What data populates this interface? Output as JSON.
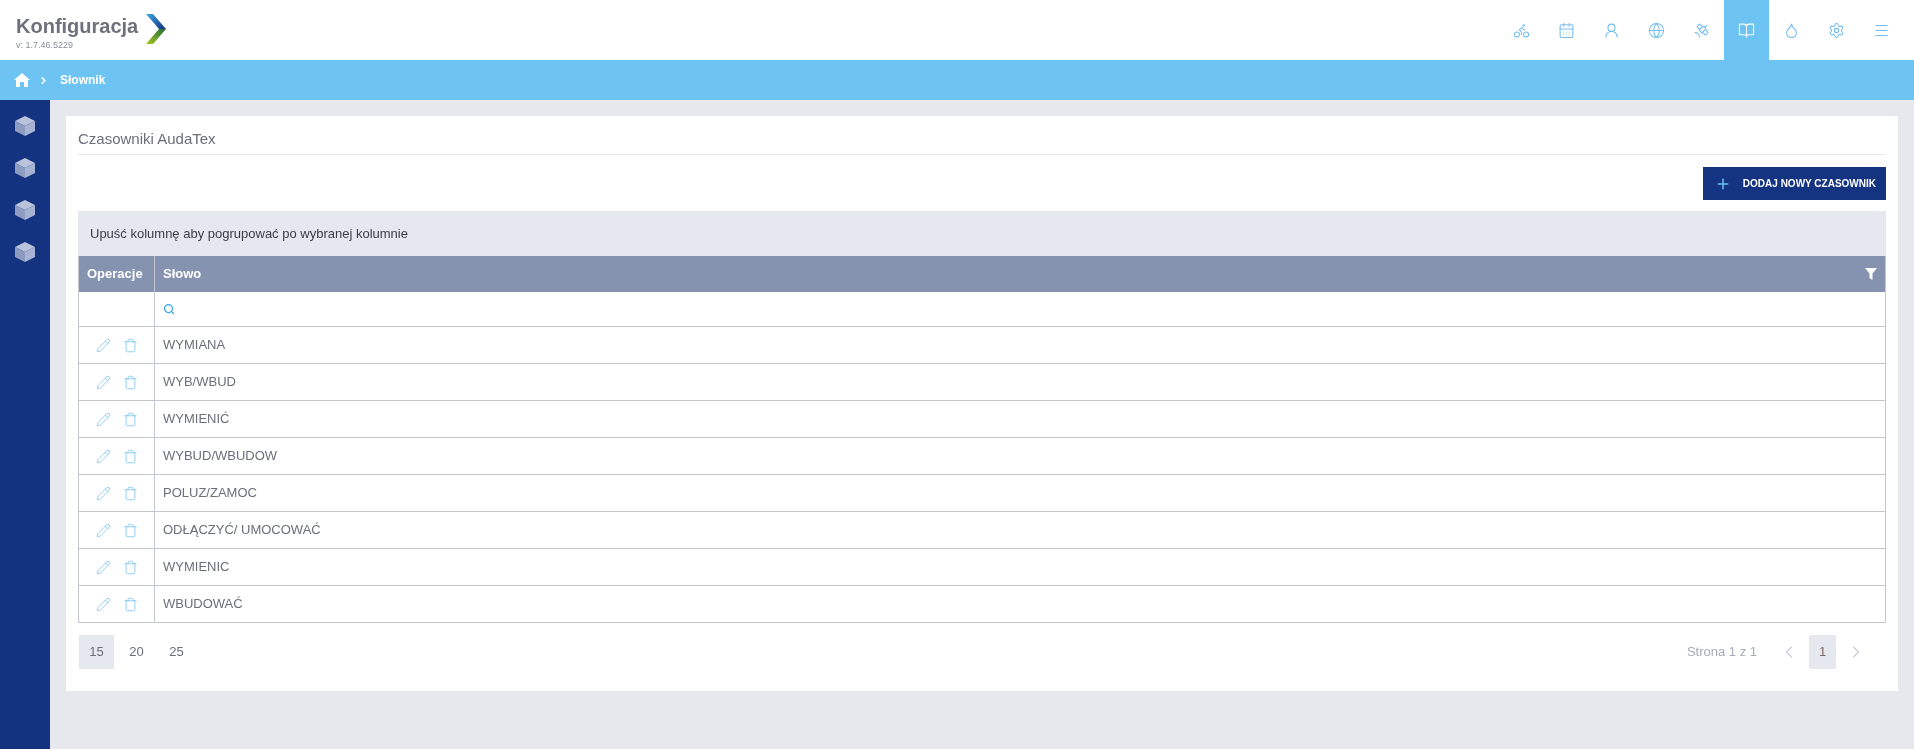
{
  "header": {
    "title": "Konfiguracja",
    "version": "v: 1.7.46.5229",
    "nav": [
      {
        "kind": "bicycle",
        "selected": false
      },
      {
        "kind": "calendar",
        "selected": false
      },
      {
        "kind": "person",
        "selected": false
      },
      {
        "kind": "globe",
        "selected": false
      },
      {
        "kind": "satellite",
        "selected": false
      },
      {
        "kind": "book",
        "selected": true
      },
      {
        "kind": "drop",
        "selected": false
      },
      {
        "kind": "gear",
        "selected": false
      },
      {
        "kind": "menu",
        "selected": false
      }
    ]
  },
  "breadcrumb": {
    "current": "Słownik"
  },
  "page": {
    "title": "Czasowniki AudaTex",
    "add_button": "DODAJ NOWY CZASOWNIK",
    "group_panel": "Upuść kolumnę aby pogrupować po wybranej kolumnie"
  },
  "table": {
    "columns": [
      "Operacje",
      "Słowo"
    ],
    "rows": [
      {
        "word": "WYMIANA"
      },
      {
        "word": "WYB/WBUD"
      },
      {
        "word": "WYMIENIĆ"
      },
      {
        "word": "WYBUD/WBUDOW"
      },
      {
        "word": "POLUZ/ZAMOC"
      },
      {
        "word": "ODŁĄCZYĆ/ UMOCOWAĆ"
      },
      {
        "word": "WYMIENIC"
      },
      {
        "word": "WBUDOWAĆ"
      }
    ]
  },
  "pagination": {
    "page_sizes": [
      {
        "label": "15",
        "selected": true
      },
      {
        "label": "20",
        "selected": false
      },
      {
        "label": "25",
        "selected": false
      }
    ],
    "page_info": "Strona 1 z 1",
    "prev": {
      "disabled": true
    },
    "pages": [
      {
        "label": "1",
        "selected": true
      }
    ],
    "next": {
      "disabled": true
    }
  }
}
